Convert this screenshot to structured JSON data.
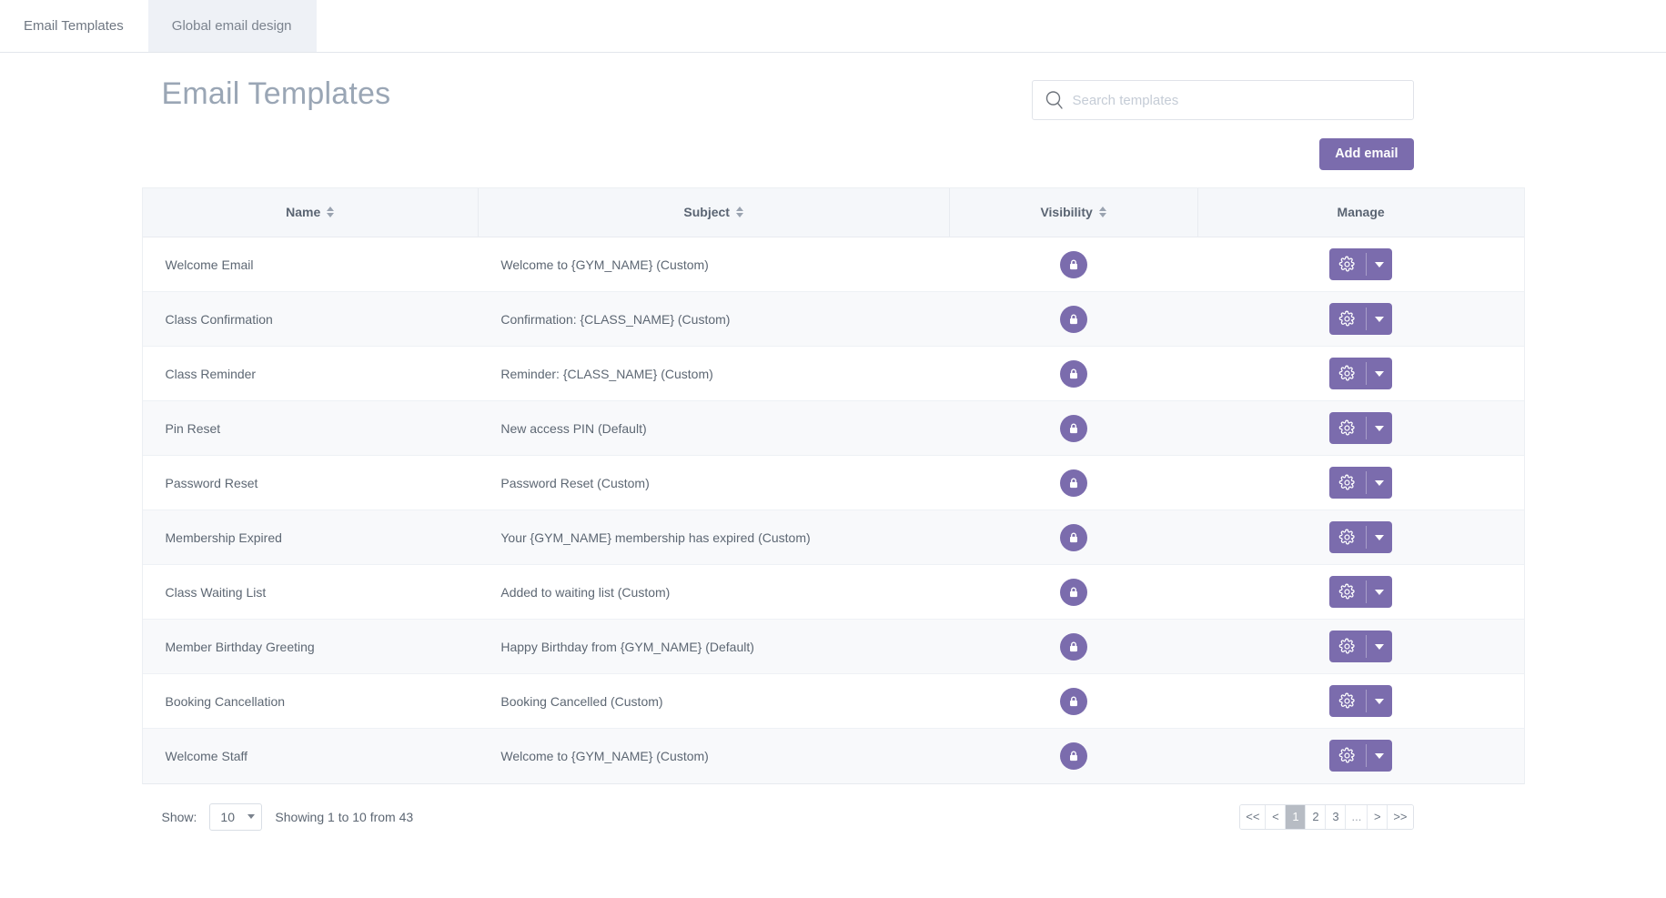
{
  "tabs": [
    {
      "label": "Email Templates",
      "active": true
    },
    {
      "label": "Global email design",
      "active": false
    }
  ],
  "header": {
    "title": "Email Templates"
  },
  "search": {
    "placeholder": "Search templates",
    "value": "",
    "icon": "search-icon"
  },
  "toolbar": {
    "add_email_label": "Add email"
  },
  "table": {
    "columns": [
      {
        "label": "Name",
        "sortable": true
      },
      {
        "label": "Subject",
        "sortable": true
      },
      {
        "label": "Visibility",
        "sortable": true
      },
      {
        "label": "Manage",
        "sortable": false
      }
    ],
    "rows": [
      {
        "name": "Welcome Email",
        "subject": "Welcome to {GYM_NAME} (Custom)",
        "visibility": "locked",
        "visibility_icon": "lock-icon",
        "manage_icon": "gear-icon",
        "manage_caret": "chevron-down-icon"
      },
      {
        "name": "Class Confirmation",
        "subject": "Confirmation: {CLASS_NAME} (Custom)",
        "visibility": "locked",
        "visibility_icon": "lock-icon",
        "manage_icon": "gear-icon",
        "manage_caret": "chevron-down-icon"
      },
      {
        "name": "Class Reminder",
        "subject": "Reminder: {CLASS_NAME} (Custom)",
        "visibility": "locked",
        "visibility_icon": "lock-icon",
        "manage_icon": "gear-icon",
        "manage_caret": "chevron-down-icon"
      },
      {
        "name": "Pin Reset",
        "subject": "New access PIN (Default)",
        "visibility": "locked",
        "visibility_icon": "lock-icon",
        "manage_icon": "gear-icon",
        "manage_caret": "chevron-down-icon"
      },
      {
        "name": "Password Reset",
        "subject": "Password Reset (Custom)",
        "visibility": "locked",
        "visibility_icon": "lock-icon",
        "manage_icon": "gear-icon",
        "manage_caret": "chevron-down-icon"
      },
      {
        "name": "Membership Expired",
        "subject": "Your {GYM_NAME} membership has expired (Custom)",
        "visibility": "locked",
        "visibility_icon": "lock-icon",
        "manage_icon": "gear-icon",
        "manage_caret": "chevron-down-icon"
      },
      {
        "name": "Class Waiting List",
        "subject": "Added to waiting list (Custom)",
        "visibility": "locked",
        "visibility_icon": "lock-icon",
        "manage_icon": "gear-icon",
        "manage_caret": "chevron-down-icon"
      },
      {
        "name": "Member Birthday Greeting",
        "subject": "Happy Birthday from {GYM_NAME} (Default)",
        "visibility": "locked",
        "visibility_icon": "lock-icon",
        "manage_icon": "gear-icon",
        "manage_caret": "chevron-down-icon"
      },
      {
        "name": "Booking Cancellation",
        "subject": "Booking Cancelled (Custom)",
        "visibility": "locked",
        "visibility_icon": "lock-icon",
        "manage_icon": "gear-icon",
        "manage_caret": "chevron-down-icon"
      },
      {
        "name": "Welcome Staff",
        "subject": "Welcome to {GYM_NAME} (Custom)",
        "visibility": "locked",
        "visibility_icon": "lock-icon",
        "manage_icon": "gear-icon",
        "manage_caret": "chevron-down-icon"
      }
    ]
  },
  "footer": {
    "show_label": "Show:",
    "page_size": "10",
    "showing_text": "Showing 1 to 10 from 43",
    "pagination": [
      {
        "label": "<<",
        "name": "first",
        "active": false
      },
      {
        "label": "<",
        "name": "prev",
        "active": false
      },
      {
        "label": "1",
        "name": "page-1",
        "active": true
      },
      {
        "label": "2",
        "name": "page-2",
        "active": false
      },
      {
        "label": "3",
        "name": "page-3",
        "active": false
      },
      {
        "label": "...",
        "name": "ellipsis",
        "active": false
      },
      {
        "label": ">",
        "name": "next",
        "active": false
      },
      {
        "label": ">>",
        "name": "last",
        "active": false
      }
    ]
  },
  "colors": {
    "accent_purple": "#7b6cad",
    "title_gray": "#9aa6b5",
    "header_bg": "#f5f7fa",
    "row_alt_bg": "#f8f9fb",
    "active_page_bg": "#b7bcc4"
  }
}
